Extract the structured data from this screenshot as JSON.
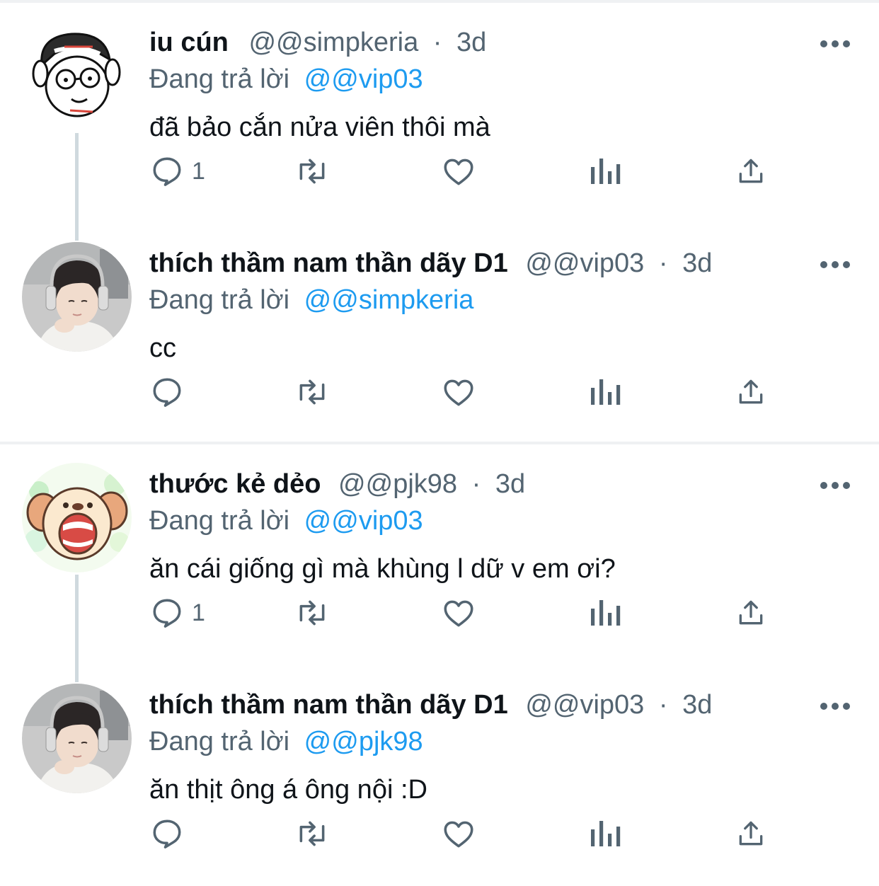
{
  "reply_prefix": "Đang trả lời",
  "tweets": [
    {
      "avatar": "cartoon-dog-glasses-avatar",
      "name": "iu cún",
      "handle": "@@simpkeria",
      "dot": "·",
      "time": "3d",
      "reply_to": "@@vip03",
      "text": "đã bảo cắn nửa viên thôi mà",
      "reply_count": "1"
    },
    {
      "avatar": "boy-headphones-photo-avatar",
      "name": "thích thầm nam thần dãy D1",
      "handle": "@@vip03",
      "dot": "·",
      "time": "3d",
      "reply_to": "@@simpkeria",
      "text": "cc",
      "reply_count": ""
    },
    {
      "avatar": "cartoon-screaming-dog-avatar",
      "name": "thước kẻ dẻo",
      "handle": "@@pjk98",
      "dot": "·",
      "time": "3d",
      "reply_to": "@@vip03",
      "text": "ăn cái giống gì mà khùng l dữ v em ơi?",
      "reply_count": "1"
    },
    {
      "avatar": "boy-headphones-photo-avatar",
      "name": "thích thầm nam thần dãy D1",
      "handle": "@@vip03",
      "dot": "·",
      "time": "3d",
      "reply_to": "@@pjk98",
      "text": "ăn thịt ông á ông nội :D",
      "reply_count": ""
    }
  ],
  "colors": {
    "text": "#0f1419",
    "secondary": "#536471",
    "accent": "#1d9bf0",
    "thread_line": "#cfd9de",
    "separator": "#eff1f3"
  }
}
